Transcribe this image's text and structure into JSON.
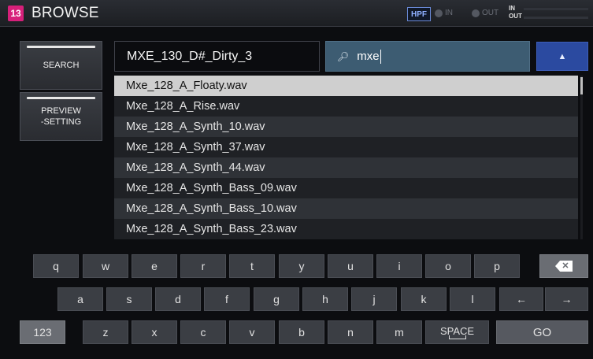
{
  "header": {
    "slot": "13",
    "title": "BROWSE",
    "hpf": "HPF",
    "in_label": "IN",
    "out_label": "OUT",
    "meter_in": "IN",
    "meter_out": "OUT"
  },
  "sidebar": {
    "search_label": "SEARCH",
    "preview_line1": "PREVIEW",
    "preview_line2": "-SETTING"
  },
  "filename_field": {
    "value": "MXE_130_D#_Dirty_3"
  },
  "search_field": {
    "value": "mxe"
  },
  "files": [
    "Mxe_128_A_Floaty.wav",
    "Mxe_128_A_Rise.wav",
    "Mxe_128_A_Synth_10.wav",
    "Mxe_128_A_Synth_37.wav",
    "Mxe_128_A_Synth_44.wav",
    "Mxe_128_A_Synth_Bass_09.wav",
    "Mxe_128_A_Synth_Bass_10.wav",
    "Mxe_128_A_Synth_Bass_23.wav"
  ],
  "selected_index": 0,
  "keyboard": {
    "row1": [
      "q",
      "w",
      "e",
      "r",
      "t",
      "y",
      "u",
      "i",
      "o",
      "p"
    ],
    "row2": [
      "a",
      "s",
      "d",
      "f",
      "g",
      "h",
      "j",
      "k",
      "l"
    ],
    "row3": [
      "z",
      "x",
      "c",
      "v",
      "b",
      "n",
      "m"
    ],
    "numbers_label": "123",
    "space_label": "SPACE",
    "go_label": "GO",
    "left_arrow": "←",
    "right_arrow": "→",
    "backspace_glyph": "✕"
  },
  "colors": {
    "slot_badge": "#d6207a",
    "search_field": "#3d5c72",
    "scroll_button": "#2b4aa0",
    "selected_row": "#cfcfcf"
  }
}
